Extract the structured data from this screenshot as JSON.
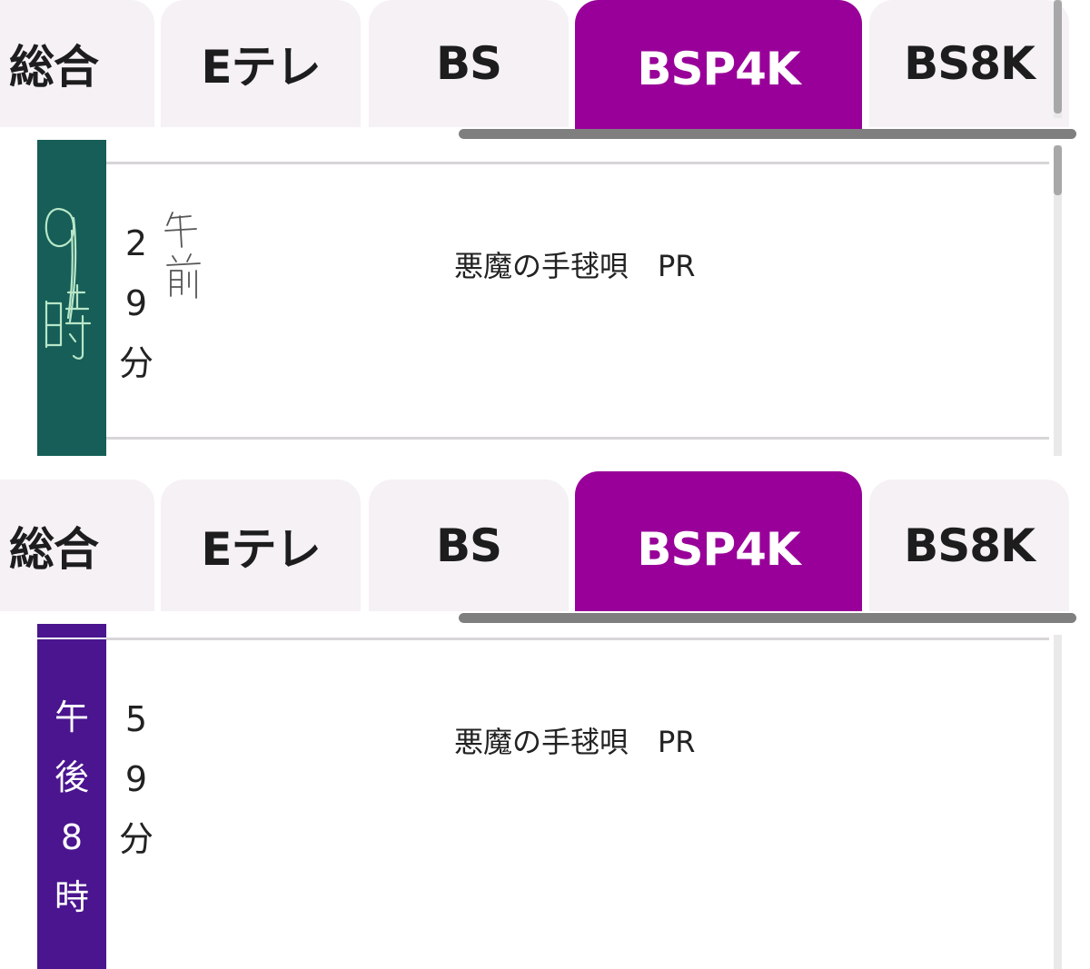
{
  "tabs": [
    {
      "label": "総合",
      "active": false
    },
    {
      "label": "Eテレ",
      "active": false
    },
    {
      "label": "BS",
      "active": false
    },
    {
      "label": "BSP4K",
      "active": true
    },
    {
      "label": "BS8K",
      "active": false
    }
  ],
  "colors": {
    "tab_inactive_bg": "#f5f1f5",
    "tab_active_bg": "#990099",
    "tab_active_text": "#ffffff",
    "hour_strip_panel1": "#165e57",
    "hour_strip_panel2": "#4a158f",
    "handwriting_on_strip": "#b8e6c8",
    "handwriting_on_white": "#555555"
  },
  "panel1": {
    "minute_chars": [
      "2",
      "9",
      "分"
    ],
    "program_title": "悪魔の手毬唄　PR",
    "handwritten_hour": [
      "9",
      "時"
    ],
    "handwritten_ampm": [
      "午",
      "前"
    ]
  },
  "panel2": {
    "hour_chars": [
      "午",
      "後",
      "8",
      "時"
    ],
    "minute_chars": [
      "5",
      "9",
      "分"
    ],
    "program_title": "悪魔の手毬唄　PR"
  }
}
